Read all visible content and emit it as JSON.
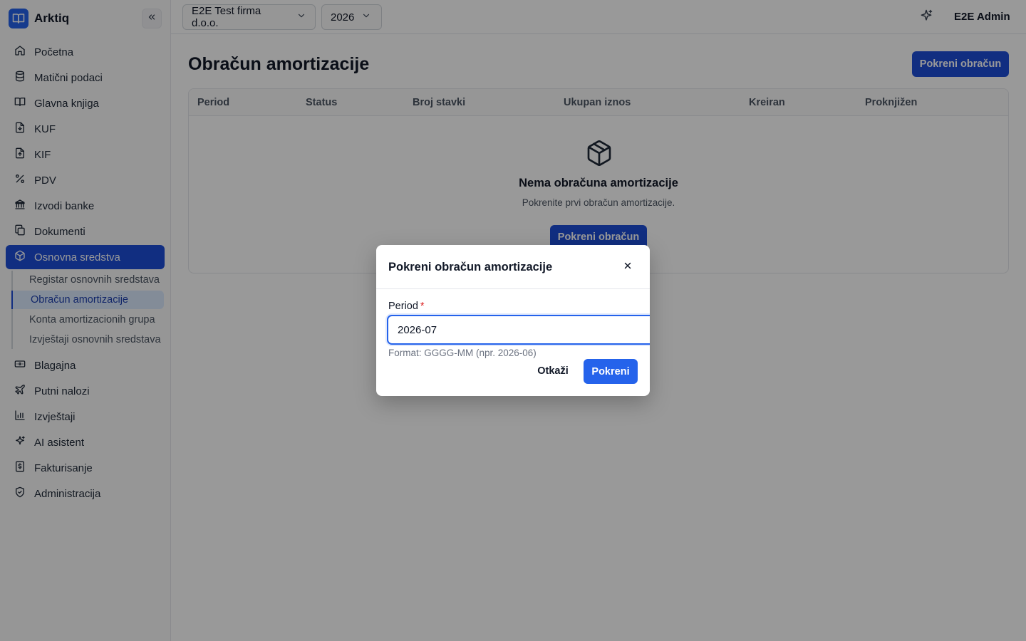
{
  "app": {
    "name": "Arktiq"
  },
  "sidebar": {
    "items": [
      {
        "label": "Početna",
        "icon": "home-icon"
      },
      {
        "label": "Matični podaci",
        "icon": "database-icon"
      },
      {
        "label": "Glavna knjiga",
        "icon": "book-open-icon"
      },
      {
        "label": "KUF",
        "icon": "file-download-icon"
      },
      {
        "label": "KIF",
        "icon": "file-upload-icon"
      },
      {
        "label": "PDV",
        "icon": "percent-icon"
      },
      {
        "label": "Izvodi banke",
        "icon": "bank-icon"
      },
      {
        "label": "Dokumenti",
        "icon": "documents-icon"
      },
      {
        "label": "Osnovna sredstva",
        "icon": "box-icon",
        "active": true
      },
      {
        "label": "Blagajna",
        "icon": "cash-icon"
      },
      {
        "label": "Putni nalozi",
        "icon": "plane-icon"
      },
      {
        "label": "Izvještaji",
        "icon": "bar-chart-icon"
      },
      {
        "label": "AI asistent",
        "icon": "sparkle-icon"
      },
      {
        "label": "Fakturisanje",
        "icon": "invoice-dollar-icon"
      },
      {
        "label": "Administracija",
        "icon": "shield-icon"
      }
    ],
    "subitems": [
      {
        "label": "Registar osnovnih sredstava"
      },
      {
        "label": "Obračun amortizacije",
        "active": true
      },
      {
        "label": "Konta amortizacionih grupa"
      },
      {
        "label": "Izvještaji osnovnih sredstava"
      }
    ]
  },
  "topbar": {
    "company": "E2E Test firma d.o.o.",
    "year": "2026",
    "user": "E2E Admin"
  },
  "page": {
    "title": "Obračun amortizacije",
    "run_button": "Pokreni obračun"
  },
  "table": {
    "columns": [
      "Period",
      "Status",
      "Broj stavki",
      "Ukupan iznos",
      "Kreiran",
      "Proknjižen"
    ],
    "empty_title": "Nema obračuna amortizacije",
    "empty_subtitle": "Pokrenite prvi obračun amortizacije.",
    "empty_button": "Pokreni obračun"
  },
  "modal": {
    "title": "Pokreni obračun amortizacije",
    "close": "×",
    "field_label": "Period",
    "required_mark": "*",
    "field_value": "2026-07",
    "hint": "Format: GGGG-MM (npr. 2026-06)",
    "cancel": "Otkaži",
    "submit": "Pokreni"
  },
  "colors": {
    "primary": "#1d4ed8",
    "primary_bright": "#2563eb",
    "overlay": "rgba(0,0,0,0.40)",
    "required": "#dc2626"
  }
}
